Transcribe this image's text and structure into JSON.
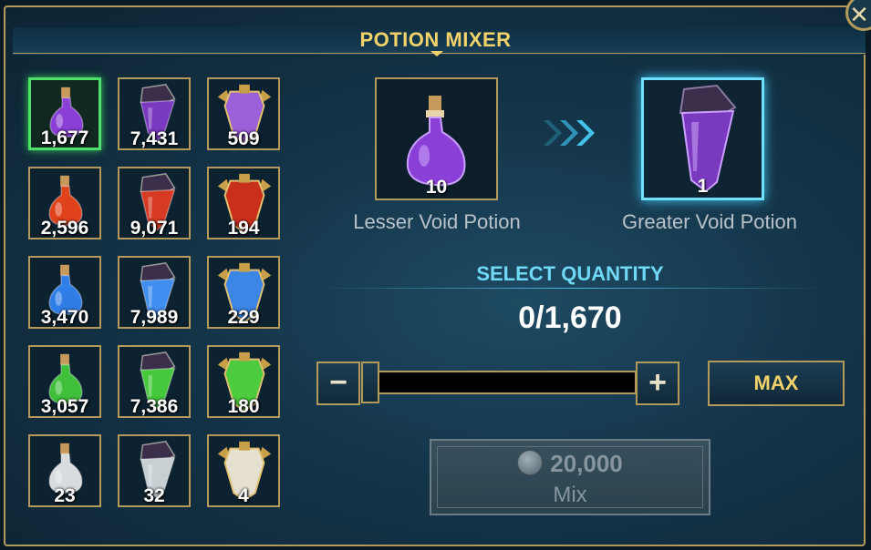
{
  "header": {
    "title": "POTION MIXER"
  },
  "inventory": [
    {
      "name": "lesser-void-potion",
      "count": "1,677",
      "color": "#8a3fd6",
      "selected": true
    },
    {
      "name": "greater-void-potion",
      "count": "7,431",
      "color": "#7a3ac0",
      "selected": false
    },
    {
      "name": "superior-void-potion",
      "count": "509",
      "color": "#9b5fd8",
      "selected": false
    },
    {
      "name": "lesser-force-potion",
      "count": "2,596",
      "color": "#e0421c",
      "selected": false
    },
    {
      "name": "greater-force-potion",
      "count": "9,071",
      "color": "#d63a22",
      "selected": false
    },
    {
      "name": "superior-force-potion",
      "count": "194",
      "color": "#c9301c",
      "selected": false
    },
    {
      "name": "lesser-magic-potion",
      "count": "3,470",
      "color": "#2f7de6",
      "selected": false
    },
    {
      "name": "greater-magic-potion",
      "count": "7,989",
      "color": "#3f8ef0",
      "selected": false
    },
    {
      "name": "superior-magic-potion",
      "count": "229",
      "color": "#3c86e6",
      "selected": false
    },
    {
      "name": "lesser-spirit-potion",
      "count": "3,057",
      "color": "#3fbf3a",
      "selected": false
    },
    {
      "name": "greater-spirit-potion",
      "count": "7,386",
      "color": "#45c83c",
      "selected": false
    },
    {
      "name": "superior-spirit-potion",
      "count": "180",
      "color": "#4ccb3e",
      "selected": false
    },
    {
      "name": "lesser-arcane-potion",
      "count": "23",
      "color": "#d8dcde",
      "selected": false
    },
    {
      "name": "greater-arcane-potion",
      "count": "32",
      "color": "#c8d0d4",
      "selected": false
    },
    {
      "name": "superior-arcane-potion",
      "count": "4",
      "color": "#e6e0d0",
      "selected": false
    }
  ],
  "recipe": {
    "input": {
      "name": "Lesser Void Potion",
      "count": "10"
    },
    "output": {
      "name": "Greater Void Potion",
      "count": "1"
    }
  },
  "quantity": {
    "label": "SELECT QUANTITY",
    "display": "0/1,670",
    "current": 0,
    "max": 1670,
    "minus": "−",
    "plus": "+",
    "max_label": "MAX"
  },
  "mix": {
    "cost": "20,000",
    "label": "Mix",
    "enabled": false
  },
  "colors": {
    "gold": "#b39a5a",
    "title": "#f2d36b",
    "select_accent": "#6fd9f5",
    "selected_slot": "#4ee06a"
  }
}
